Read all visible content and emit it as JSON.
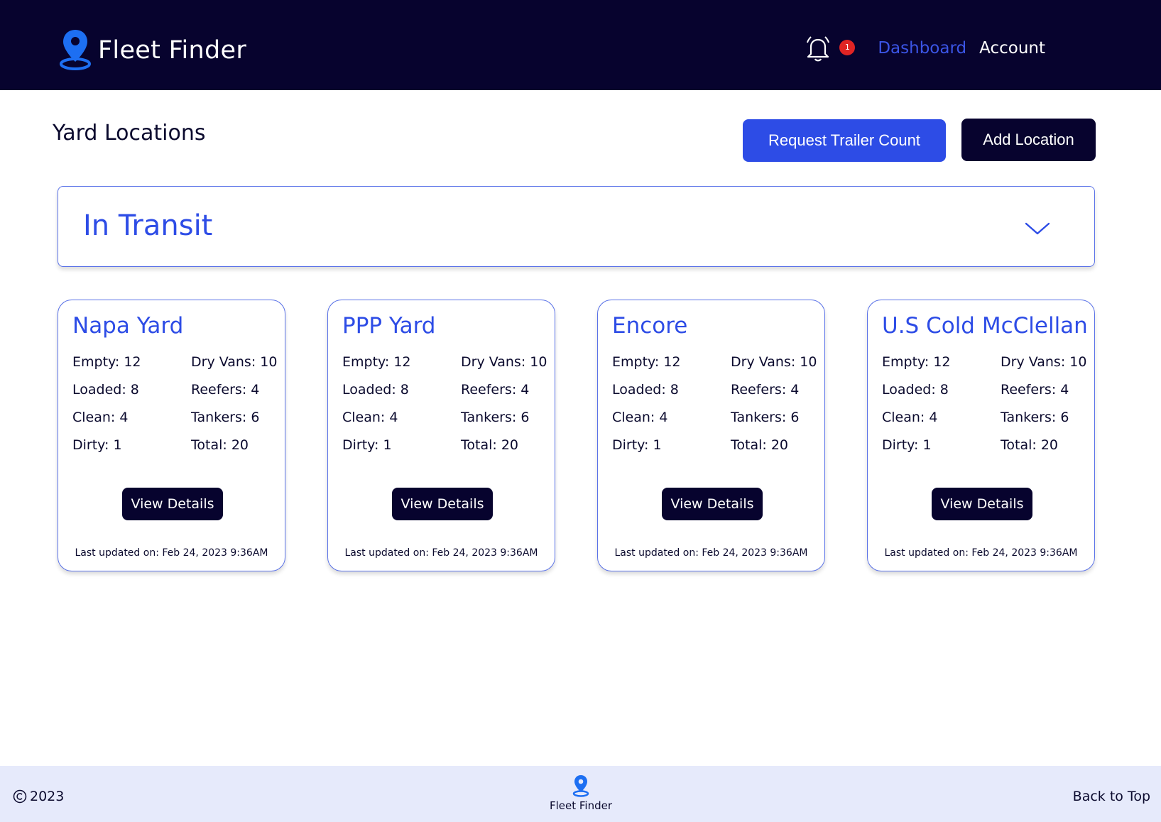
{
  "header": {
    "brand_name": "Fleet Finder",
    "notification_count": "1",
    "nav": {
      "dashboard": "Dashboard",
      "account": "Account"
    }
  },
  "page": {
    "title": "Yard Locations",
    "request_button": "Request Trailer Count",
    "add_button": "Add Location"
  },
  "transit_panel": {
    "title": "In Transit"
  },
  "cards": [
    {
      "title": "Napa Yard",
      "empty": "Empty: 12",
      "loaded": "Loaded: 8",
      "clean": "Clean: 4",
      "dirty": "Dirty: 1",
      "dry_vans": "Dry Vans: 10",
      "reefers": "Reefers: 4",
      "tankers": "Tankers: 6",
      "total": "Total: 20",
      "button": "View Details",
      "updated": "Last updated on: Feb 24, 2023 9:36AM"
    },
    {
      "title": "PPP Yard",
      "empty": "Empty: 12",
      "loaded": "Loaded: 8",
      "clean": "Clean: 4",
      "dirty": "Dirty: 1",
      "dry_vans": "Dry Vans: 10",
      "reefers": "Reefers: 4",
      "tankers": "Tankers: 6",
      "total": "Total: 20",
      "button": "View Details",
      "updated": "Last updated on: Feb 24, 2023 9:36AM"
    },
    {
      "title": "Encore",
      "empty": "Empty: 12",
      "loaded": "Loaded: 8",
      "clean": "Clean: 4",
      "dirty": "Dirty: 1",
      "dry_vans": "Dry Vans: 10",
      "reefers": "Reefers: 4",
      "tankers": "Tankers: 6",
      "total": "Total: 20",
      "button": "View Details",
      "updated": "Last updated on: Feb 24, 2023 9:36AM"
    },
    {
      "title": "U.S Cold McClellan",
      "empty": "Empty: 12",
      "loaded": "Loaded: 8",
      "clean": "Clean: 4",
      "dirty": "Dirty: 1",
      "dry_vans": "Dry Vans: 10",
      "reefers": "Reefers: 4",
      "tankers": "Tankers: 6",
      "total": "Total: 20",
      "button": "View Details",
      "updated": "Last updated on: Feb 24, 2023 9:36AM"
    }
  ],
  "footer": {
    "copyright": "2023",
    "brand_name": "Fleet Finder",
    "back_to_top": "Back to Top"
  },
  "colors": {
    "header_bg": "#07032e",
    "accent_blue": "#2d4ce6",
    "footer_bg": "#e6eafb",
    "badge_red": "#e02424"
  },
  "icons": [
    "map-pin-icon",
    "bell-icon",
    "chevron-down-icon",
    "copyright-icon"
  ]
}
